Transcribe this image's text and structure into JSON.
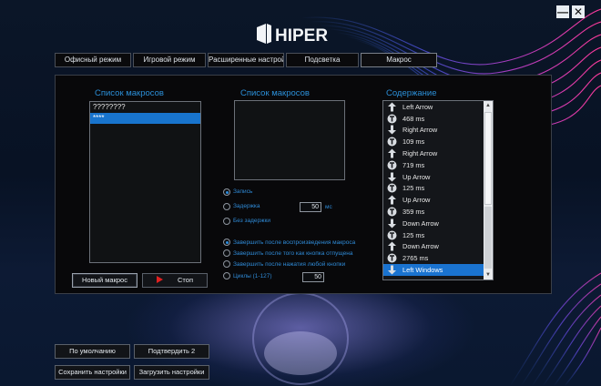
{
  "window": {
    "minimize_icon": "minimize-icon",
    "close_icon": "close-icon",
    "minimize_glyph": "—",
    "close_glyph": "✕"
  },
  "brand": {
    "name": "HIPER",
    "icon": "hiper-logo"
  },
  "tabs": [
    {
      "label": "Офисный режим",
      "active": false
    },
    {
      "label": "Игровой режим",
      "active": false
    },
    {
      "label": "Расширенные настройки",
      "active": false
    },
    {
      "label": "Подсветка",
      "active": false
    },
    {
      "label": "Макрос",
      "active": true
    }
  ],
  "macro_list": {
    "heading": "Список макросов",
    "items": [
      "????????",
      "****"
    ],
    "selected_index": 1
  },
  "macro_keys": {
    "heading": "Список макросов"
  },
  "recording": {
    "record_label": "Запись",
    "delay_label": "Задержка",
    "delay_value": "50",
    "delay_unit": "мс",
    "no_delay_label": "Без задержки",
    "selected": "record"
  },
  "repeat": {
    "opt1": "Завершить после воспроизведения макроса",
    "opt2": "Завершить после того как кнопка отпущена",
    "opt3": "Завершить после нажатия любой кнопки",
    "cycles_label": "Циклы (1-127)",
    "cycles_value": "50",
    "selected": "opt1"
  },
  "buttons": {
    "new_macro": "Новый макрос",
    "stop": "Стоп",
    "stop_icon": "play-icon"
  },
  "content": {
    "heading": "Содержание",
    "rows": [
      {
        "icon": "key-up-arrow-icon",
        "text": "Left Arrow"
      },
      {
        "icon": "timer-icon",
        "text": "468 ms"
      },
      {
        "icon": "key-down-arrow-icon",
        "text": "Right Arrow"
      },
      {
        "icon": "timer-icon",
        "text": "109 ms"
      },
      {
        "icon": "key-up-arrow-icon",
        "text": "Right Arrow"
      },
      {
        "icon": "timer-icon",
        "text": "719 ms"
      },
      {
        "icon": "key-down-arrow-icon",
        "text": "Up Arrow"
      },
      {
        "icon": "timer-icon",
        "text": "125 ms"
      },
      {
        "icon": "key-up-arrow-icon",
        "text": "Up Arrow"
      },
      {
        "icon": "timer-icon",
        "text": "359 ms"
      },
      {
        "icon": "key-down-arrow-icon",
        "text": "Down Arrow"
      },
      {
        "icon": "timer-icon",
        "text": "125 ms"
      },
      {
        "icon": "key-up-arrow-icon",
        "text": "Down Arrow"
      },
      {
        "icon": "timer-icon",
        "text": "2765 ms"
      },
      {
        "icon": "key-down-arrow-icon",
        "text": "Left Windows"
      }
    ],
    "selected_index": 14,
    "scroll_up": "▲",
    "scroll_down": "▼"
  },
  "footer": {
    "defaults": "По умолчанию",
    "confirm": "Подтвердить 2",
    "save": "Сохранить настройки",
    "load": "Загрузить настройки"
  },
  "colors": {
    "accent_blue": "#2b8fd8",
    "selection": "#1874cd",
    "stop_red": "#e02020"
  }
}
